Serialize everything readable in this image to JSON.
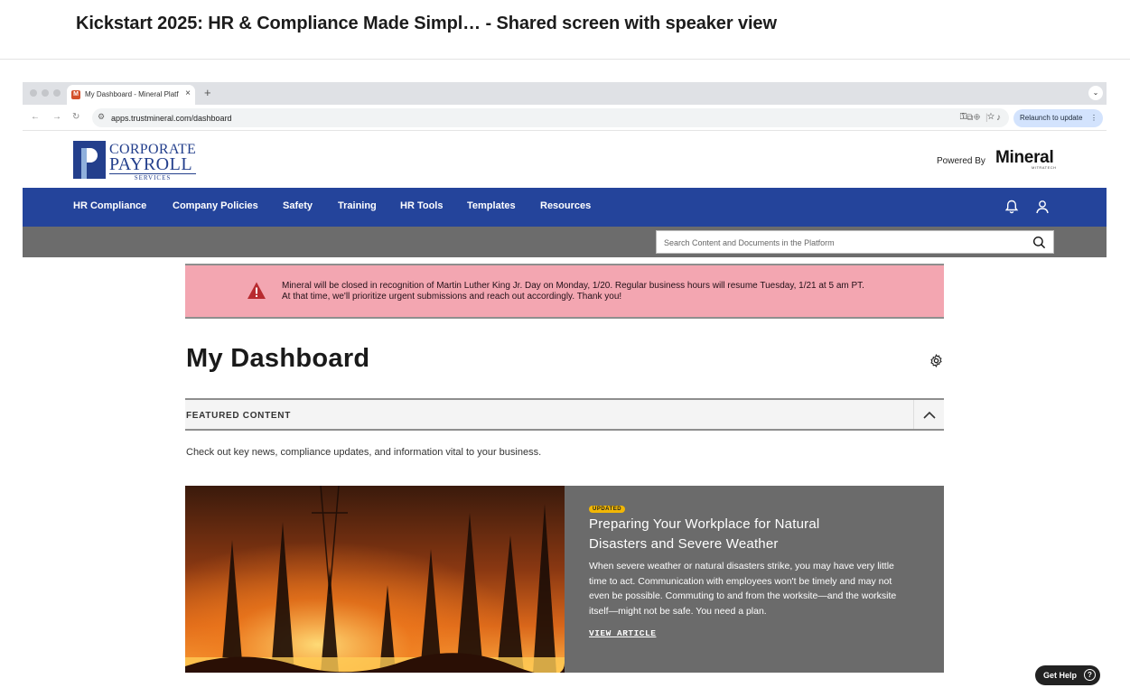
{
  "meeting": {
    "title": "Kickstart 2025: HR & Compliance Made Simpl…  - Shared screen with speaker view"
  },
  "browser": {
    "tab_title": "My Dashboard - Mineral Platf",
    "tab_close": "×",
    "new_tab": "+",
    "tab_menu": "⌄",
    "url": "apps.trustmineral.com/dashboard",
    "relaunch_label": "Relaunch to update",
    "relaunch_menu": "⋮"
  },
  "site": {
    "logo_line1": "CORPORATE",
    "logo_line2": "PAYROLL",
    "logo_line3": "SERVICES",
    "powered_by": "Powered By",
    "mineral": "Mineral",
    "mineral_sub": "MITRATECH"
  },
  "nav": {
    "items": [
      {
        "label": "HR Compliance"
      },
      {
        "label": "Company Policies"
      },
      {
        "label": "Safety"
      },
      {
        "label": "Training"
      },
      {
        "label": "HR Tools"
      },
      {
        "label": "Templates"
      },
      {
        "label": "Resources"
      }
    ]
  },
  "search": {
    "placeholder": "Search Content and Documents in the Platform"
  },
  "alert": {
    "line1": "Mineral will be closed in recognition of Martin Luther King Jr. Day on Monday, 1/20. Regular business hours will resume Tuesday, 1/21 at 5 am PT.",
    "line2": "At that time, we'll prioritize urgent submissions and reach out accordingly. Thank you!"
  },
  "dashboard": {
    "title": "My Dashboard",
    "featured_label": "FEATURED CONTENT",
    "featured_desc": "Check out key news, compliance updates, and information vital to your business."
  },
  "article": {
    "badge": "UPDATED",
    "title": "Preparing Your Workplace for Natural Disasters and Severe Weather",
    "body": "When severe weather or natural disasters strike, you may have very little time to act. Communication with employees won't be timely and may not even be possible. Commuting to and from the worksite—and the worksite itself—might not be safe. You need a plan.",
    "link": "VIEW ARTICLE"
  },
  "help": {
    "label": "Get Help",
    "icon": "?"
  },
  "colors": {
    "nav_blue": "#24449b",
    "alert_pink": "#f3a6b1",
    "card_gray": "#6b6b6b",
    "badge_yellow": "#f2b705"
  }
}
